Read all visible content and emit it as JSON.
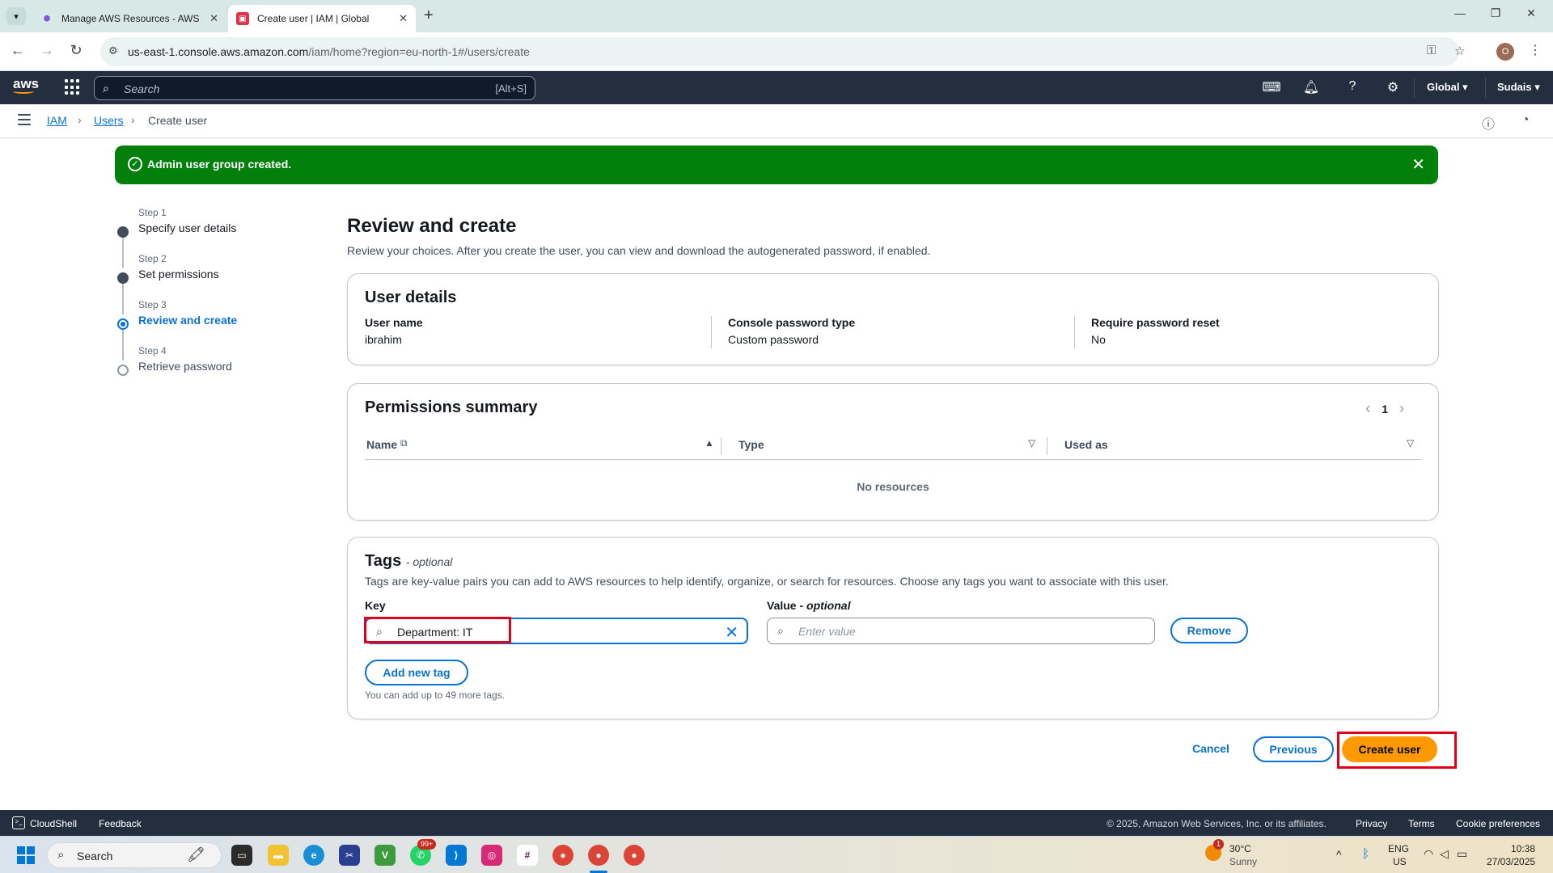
{
  "browser": {
    "tabs": [
      {
        "label": "Manage AWS Resources - AWS",
        "active": false
      },
      {
        "label": "Create user | IAM | Global",
        "active": true
      }
    ],
    "url_host": "us-east-1.console.aws.amazon.com",
    "url_path": "/iam/home?region=eu-north-1#/users/create",
    "profile_initial": "O"
  },
  "aws_nav": {
    "logo": "aws",
    "search_placeholder": "Search",
    "search_shortcut": "[Alt+S]",
    "region": "Global ▾",
    "account": "Sudais ▾"
  },
  "breadcrumb": [
    "IAM",
    "Users",
    "Create user"
  ],
  "flash": {
    "message": "Admin user group created."
  },
  "steps": [
    {
      "num": "Step 1",
      "title": "Specify user details",
      "state": "done"
    },
    {
      "num": "Step 2",
      "title": "Set permissions",
      "state": "done"
    },
    {
      "num": "Step 3",
      "title": "Review and create",
      "state": "active"
    },
    {
      "num": "Step 4",
      "title": "Retrieve password",
      "state": "pending"
    }
  ],
  "main": {
    "title": "Review and create",
    "description": "Review your choices. After you create the user, you can view and download the autogenerated password, if enabled."
  },
  "user_details": {
    "heading": "User details",
    "fields": [
      {
        "label": "User name",
        "value": "ibrahim"
      },
      {
        "label": "Console password type",
        "value": "Custom password"
      },
      {
        "label": "Require password reset",
        "value": "No"
      }
    ]
  },
  "permissions": {
    "heading": "Permissions summary",
    "page": "1",
    "columns": [
      "Name",
      "Type",
      "Used as"
    ],
    "empty": "No resources"
  },
  "tags": {
    "heading": "Tags",
    "optional": "- optional",
    "description": "Tags are key-value pairs you can add to AWS resources to help identify, organize, or search for resources. Choose any tags you want to associate with this user.",
    "key_label": "Key",
    "value_label": "Value - ",
    "value_label_optional": "optional",
    "key_value": "Department: IT",
    "value_placeholder": "Enter value",
    "remove_label": "Remove",
    "add_label": "Add new tag",
    "hint": "You can add up to 49 more tags."
  },
  "actions": {
    "cancel": "Cancel",
    "previous": "Previous",
    "create": "Create user"
  },
  "footer": {
    "cloudshell": "CloudShell",
    "feedback": "Feedback",
    "copyright": "© 2025, Amazon Web Services, Inc. or its affiliates.",
    "privacy": "Privacy",
    "terms": "Terms",
    "cookies": "Cookie preferences"
  },
  "taskbar": {
    "search_placeholder": "Search",
    "whatsapp_badge": "99+",
    "weather_temp": "30°C",
    "weather_desc": "Sunny",
    "weather_badge": "1",
    "lang": "ENG",
    "region": "US",
    "time": "10:38",
    "date": "27/03/2025"
  },
  "colors": {
    "aws_nav": "#232f3e",
    "link_blue": "#0972d3",
    "success_green": "#037f0c",
    "primary_orange": "#ff9900",
    "highlight_red": "#e0001b"
  }
}
